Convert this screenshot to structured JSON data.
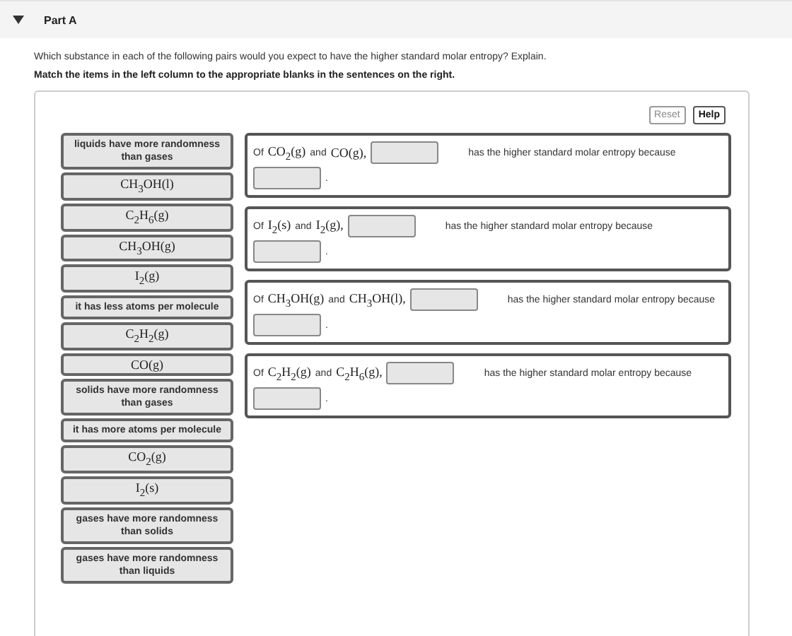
{
  "part": {
    "title": "Part A",
    "expanded": true
  },
  "question": "Which substance in each of the following pairs would you expect to have the higher standard molar entropy? Explain.",
  "instruction": "Match the items in the left column to the appropriate blanks in the sentences on the right.",
  "buttons": [
    {
      "label": "Reset",
      "disabled": true
    },
    {
      "label": "Help",
      "disabled": false
    }
  ],
  "items": [
    {
      "kind": "phrase",
      "text": "liquids have more randomness than gases"
    },
    {
      "kind": "formula",
      "text": "CH$_{3}$OH(l)"
    },
    {
      "kind": "formula",
      "text": "C$_{2}$H$_{6}$(g)"
    },
    {
      "kind": "formula",
      "text": "CH$_{3}$OH(g)"
    },
    {
      "kind": "formula",
      "text": "I$_{2}$(g)"
    },
    {
      "kind": "phrase",
      "text": "it has less atoms per molecule"
    },
    {
      "kind": "formula",
      "text": "C$_{2}$H$_{2}$(g)"
    },
    {
      "kind": "formula",
      "text": "CO(g)"
    },
    {
      "kind": "phrase",
      "text": "solids have more randomness than gases"
    },
    {
      "kind": "phrase",
      "text": "it has more atoms per molecule"
    },
    {
      "kind": "formula",
      "text": "CO$_{2}$(g)"
    },
    {
      "kind": "formula",
      "text": "I$_{2}$(s)"
    },
    {
      "kind": "phrase",
      "text": "gases have more randomness than solids"
    },
    {
      "kind": "phrase",
      "text": "gases have more randomness than liquids"
    }
  ],
  "sentences": [
    {
      "prefix": "Of",
      "first": "CO$_{2}$(g)",
      "joiner": "and",
      "second": "CO(g),",
      "middle": "has the higher standard molar entropy because",
      "end": "."
    },
    {
      "prefix": "Of",
      "first": "I$_{2}$(s)",
      "joiner": "and",
      "second": "I$_{2}$(g),",
      "middle": "has the higher standard molar entropy because",
      "end": "."
    },
    {
      "prefix": "Of",
      "first": "CH$_{3}$OH(g)",
      "joiner": "and",
      "second": "CH$_{3}$OH(l),",
      "middle": "has the higher standard molar entropy because",
      "end": "."
    },
    {
      "prefix": "Of",
      "first": "C$_{2}$H$_{2}$(g)",
      "joiner": "and",
      "second": "C$_{2}$H$_{6}$(g),",
      "middle": "has the higher standard molar entropy because",
      "end": "."
    }
  ]
}
